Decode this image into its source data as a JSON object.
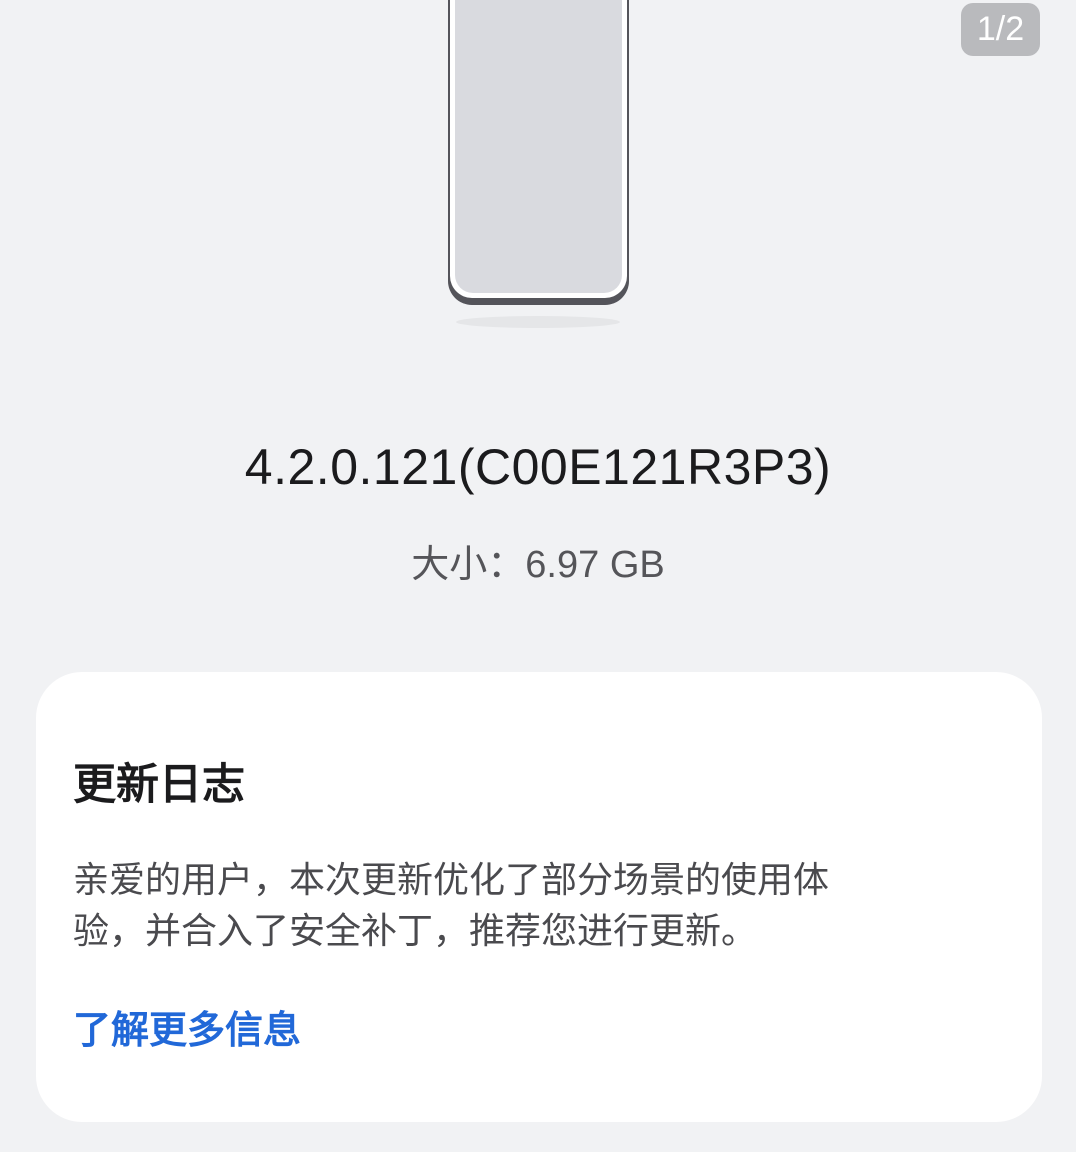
{
  "page_indicator": "1/2",
  "update": {
    "version": "4.2.0.121(C00E121R3P3)",
    "size_label": "大小：",
    "size_value": "6.97 GB"
  },
  "changelog": {
    "title": "更新日志",
    "body_line1": "亲爱的用户，本次更新优化了部分场景的使用体",
    "body_line2": "验，并合入了安全补丁，推荐您进行更新。",
    "learn_more": "了解更多信息"
  },
  "colors": {
    "background": "#f1f2f4",
    "card": "#ffffff",
    "link": "#2168d8",
    "indicator_bg": "#b9babd"
  }
}
